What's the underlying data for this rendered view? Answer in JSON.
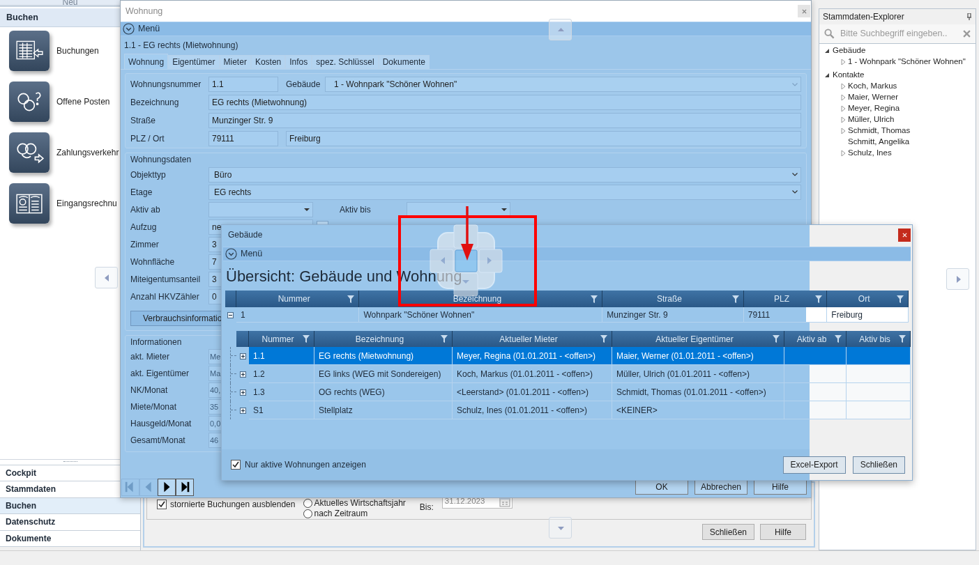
{
  "sidebar": {
    "top_label": "Neu",
    "section_title": "Buchen",
    "tiles": [
      {
        "label": "Buchungen",
        "kind": "ledger"
      },
      {
        "label": "Offene Posten",
        "kind": "open_items"
      },
      {
        "label": "Zahlungsverkehr",
        "kind": "transfer"
      },
      {
        "label": "Eingangsrechnu",
        "kind": "invoice_book"
      }
    ],
    "nav": [
      {
        "label": "Cockpit",
        "selected": false
      },
      {
        "label": "Stammdaten",
        "selected": false
      },
      {
        "label": "Buchen",
        "selected": true
      },
      {
        "label": "Datenschutz",
        "selected": false
      },
      {
        "label": "Dokumente",
        "selected": false
      }
    ]
  },
  "background_form": {
    "checkbox": {
      "label": "stornierte Buchungen ausblenden",
      "checked": true
    },
    "radios": [
      {
        "label": "Aktuelles Wirtschaftsjahr",
        "selected": false
      },
      {
        "label": "nach Zeitraum",
        "selected": false
      }
    ],
    "to_label": "Bis:",
    "to_value": "31.12.2023",
    "buttons": [
      "Schließen",
      "Hilfe"
    ]
  },
  "wohnung_window": {
    "title": "Wohnung",
    "menu": "Menü",
    "heading": "1.1 - EG rechts (Mietwohnung)",
    "tabs": [
      {
        "label": "Wohnung",
        "selected": true
      },
      {
        "label": "Eigentümer",
        "selected": false
      },
      {
        "label": "Mieter",
        "selected": false
      },
      {
        "label": "Kosten",
        "selected": false
      },
      {
        "label": "Infos",
        "selected": false
      },
      {
        "label": "spez. Schlüssel",
        "selected": false
      },
      {
        "label": "Dokumente",
        "selected": false
      }
    ],
    "number": {
      "label": "Wohnungsnummer",
      "value": "1.1"
    },
    "building": {
      "label": "Gebäude",
      "value": "1 - Wohnpark \"Schöner Wohnen\""
    },
    "name": {
      "label": "Bezeichnung",
      "value": "EG rechts (Mietwohnung)"
    },
    "street": {
      "label": "Straße",
      "value": "Munzinger Str. 9"
    },
    "zip_city": {
      "label": "PLZ / Ort",
      "zip": "79111",
      "city": "Freiburg"
    },
    "unit_data": {
      "title": "Wohnungsdaten",
      "rows": [
        {
          "kind": "combo",
          "label": "Objekttyp",
          "value": "Büro"
        },
        {
          "kind": "combo",
          "label": "Etage",
          "value": "EG rechts"
        },
        {
          "kind": "date_range",
          "label": "Aktiv ab",
          "label_2": "Aktiv bis"
        },
        {
          "kind": "lookup",
          "label": "Aufzug",
          "value": "ne"
        },
        {
          "kind": "text",
          "label": "Zimmer",
          "value": "3"
        },
        {
          "kind": "text",
          "label": "Wohnfläche",
          "value": "7"
        },
        {
          "kind": "text",
          "label": "Miteigentumsanteil",
          "value": "3"
        },
        {
          "kind": "text",
          "label": "Anzahl HKVZähler",
          "value": "0"
        }
      ],
      "button": "Verbrauchsinformatio"
    },
    "info": {
      "title": "Informationen",
      "rows": [
        {
          "label": "akt. Mieter",
          "value": "Me",
          "disabled": true
        },
        {
          "label": "akt. Eigentümer",
          "value": "Ma",
          "disabled": true
        },
        {
          "label": "NK/Monat",
          "value": "40,",
          "disabled": true
        },
        {
          "label": "Miete/Monat",
          "value": "35",
          "disabled": true
        },
        {
          "label": "Hausgeld/Monat",
          "value": "0,0",
          "disabled": true
        },
        {
          "label": "Gesamt/Monat",
          "value": "46",
          "disabled": true
        }
      ]
    },
    "nav": [
      {
        "kind": "first",
        "disabled": true
      },
      {
        "kind": "previous",
        "disabled": true
      },
      {
        "kind": "next",
        "disabled": false
      },
      {
        "kind": "last",
        "disabled": false
      }
    ],
    "buttons": [
      "OK",
      "Abbrechen",
      "Hilfe"
    ]
  },
  "gebaeude_dialog": {
    "title": "Gebäude",
    "menu": "Menü",
    "heading": "Übersicht: Gebäude und Wohnung",
    "master": {
      "columns": [
        "Nummer",
        "Bezeichnung",
        "Straße",
        "PLZ",
        "Ort"
      ],
      "row": {
        "expanded": true,
        "cells": [
          "1",
          "Wohnpark \"Schöner Wohnen\"",
          "Munzinger Str. 9",
          "79111",
          "Freiburg"
        ]
      }
    },
    "detail": {
      "columns": [
        "Nummer",
        "Bezeichnung",
        "Aktueller Mieter",
        "Aktueller Eigentümer",
        "Aktiv ab",
        "Aktiv bis"
      ],
      "rows": [
        {
          "selected": true,
          "expanded": false,
          "cells": [
            "1.1",
            "EG rechts (Mietwohnung)",
            "Meyer, Regina (01.01.2011 - <offen>)",
            "Maier, Werner (01.01.2011 - <offen>)"
          ]
        },
        {
          "selected": false,
          "expanded": false,
          "cells": [
            "1.2",
            "EG links (WEG mit Sondereigen)",
            "Koch, Markus (01.01.2011 - <offen>)",
            "Müller, Ulrich (01.01.2011 - <offen>)"
          ]
        },
        {
          "selected": false,
          "expanded": false,
          "cells": [
            "1.3",
            "OG rechts (WEG)",
            "<Leerstand> (01.01.2011 - <offen>)",
            "Schmidt, Thomas (01.01.2011 - <offen>)"
          ]
        },
        {
          "selected": false,
          "expanded": false,
          "cells": [
            "S1",
            "Stellplatz",
            "Schulz, Ines (01.01.2011 - <offen>)",
            "<KEINER>"
          ]
        }
      ]
    },
    "checkbox": {
      "label": "Nur aktive Wohnungen anzeigen",
      "checked": true
    },
    "buttons": [
      "Excel-Export",
      "Schließen"
    ]
  },
  "explorer": {
    "title": "Stammdaten-Explorer",
    "search_placeholder": "Bitte Suchbegriff eingeben..",
    "tree": [
      {
        "label": "Gebäude",
        "expanded": true,
        "children": [
          {
            "label": "1 - Wohnpark \"Schöner Wohnen\"",
            "has_children": true
          }
        ]
      },
      {
        "label": "Kontakte",
        "expanded": true,
        "children": [
          {
            "label": "Koch, Markus",
            "has_children": true
          },
          {
            "label": "Maier, Werner",
            "has_children": true
          },
          {
            "label": "Meyer, Regina",
            "has_children": true
          },
          {
            "label": "Müller, Ulrich",
            "has_children": true
          },
          {
            "label": "Schmidt, Thomas",
            "has_children": true
          },
          {
            "label": "Schmitt, Angelika",
            "has_children": false
          },
          {
            "label": "Schulz, Ines",
            "has_children": true
          }
        ]
      }
    ]
  }
}
